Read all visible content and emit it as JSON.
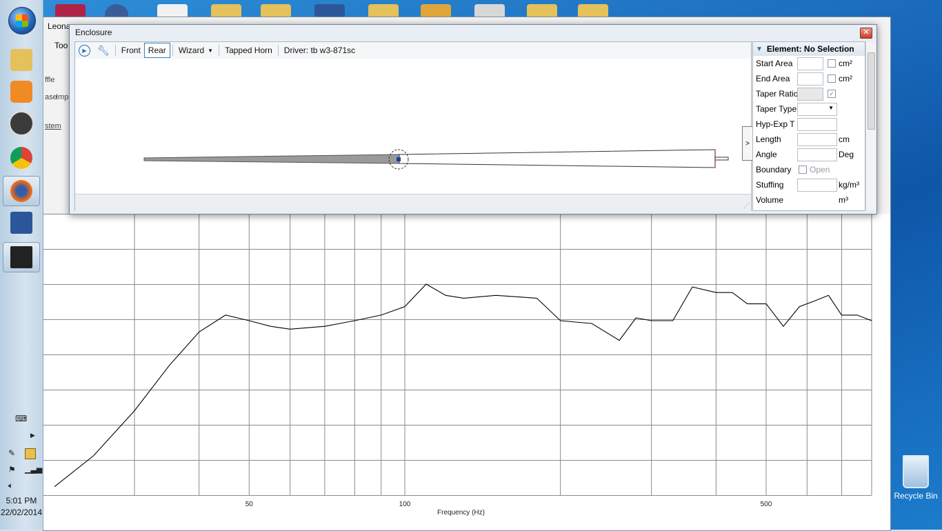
{
  "desktop": {
    "recycle_bin_label": "Recycle Bin"
  },
  "taskbar": {
    "clock_time": "5:01 PM",
    "clock_date": "22/02/2014",
    "items": [
      "windows-explorer",
      "media-player",
      "clock-gadget",
      "chrome",
      "firefox",
      "word",
      "leonardaudio"
    ]
  },
  "main_window": {
    "title_fragment": "Leona",
    "menu_fragment": "Too",
    "tab_fragments": [
      "ffle",
      "ase",
      "Impe",
      "stem"
    ]
  },
  "enclosure": {
    "title": "Enclosure",
    "toolbar": {
      "front": "Front",
      "rear": "Rear",
      "wizard": "Wizard",
      "tapped_horn": "Tapped Horn",
      "driver": "Driver: tb w3-871sc"
    },
    "expand_label": ">"
  },
  "properties": {
    "header": "Element: No Selection",
    "rows": [
      {
        "label": "Start Area",
        "unit": "cm²"
      },
      {
        "label": "End Area",
        "unit": "cm²"
      },
      {
        "label": "Taper Ratio",
        "unit": ""
      },
      {
        "label": "Taper Type",
        "unit": ""
      },
      {
        "label": "Hyp-Exp T",
        "unit": ""
      },
      {
        "label": "Length",
        "unit": "cm"
      },
      {
        "label": "Angle",
        "unit": "Deg"
      },
      {
        "label": "Boundary",
        "unit": "Open"
      },
      {
        "label": "Stuffing",
        "unit": "kg/m³"
      },
      {
        "label": "Volume",
        "unit": "m³"
      }
    ]
  },
  "chart_data": {
    "type": "line",
    "xlabel": "Frequency (Hz)",
    "ylabel": "",
    "x_scale": "log",
    "xlim": [
      20,
      800
    ],
    "x_tick_labels": [
      "50",
      "100",
      "500"
    ],
    "grid": true,
    "series": [
      {
        "x": [
          21,
          25,
          30,
          35,
          40,
          45,
          50,
          55,
          60,
          70,
          80,
          90,
          100,
          110,
          120,
          130,
          150,
          180,
          200,
          230,
          260,
          280,
          300,
          330,
          360,
          400,
          430,
          460,
          500,
          540,
          580,
          620,
          660,
          700,
          750,
          800
        ],
        "y": [
          0.03,
          0.14,
          0.3,
          0.46,
          0.58,
          0.64,
          0.62,
          0.6,
          0.59,
          0.6,
          0.62,
          0.64,
          0.67,
          0.75,
          0.71,
          0.7,
          0.71,
          0.7,
          0.62,
          0.61,
          0.55,
          0.63,
          0.62,
          0.62,
          0.74,
          0.72,
          0.72,
          0.68,
          0.68,
          0.6,
          0.67,
          0.69,
          0.71,
          0.64,
          0.64,
          0.62
        ]
      }
    ]
  }
}
